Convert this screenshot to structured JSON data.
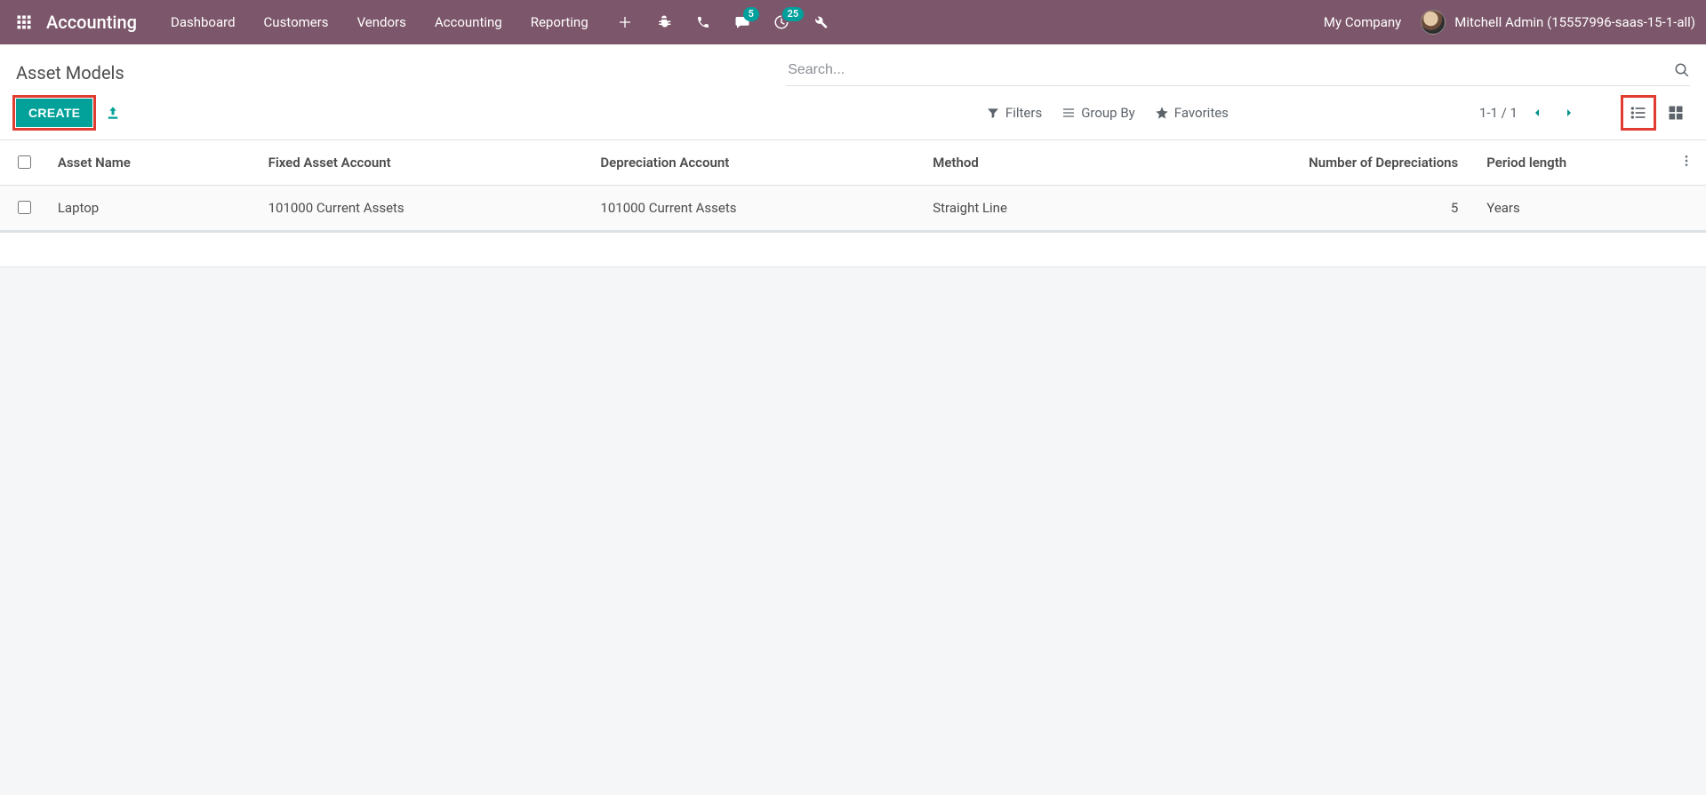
{
  "navbar": {
    "app_title": "Accounting",
    "menu": [
      "Dashboard",
      "Customers",
      "Vendors",
      "Accounting",
      "Reporting"
    ],
    "messages_badge": "5",
    "activities_badge": "25",
    "company": "My Company",
    "user": "Mitchell Admin (15557996-saas-15-1-all)"
  },
  "control_panel": {
    "breadcrumb": "Asset Models",
    "search_placeholder": "Search...",
    "create_label": "CREATE",
    "filters_label": "Filters",
    "groupby_label": "Group By",
    "favorites_label": "Favorites",
    "pager": "1-1 / 1"
  },
  "table": {
    "columns": {
      "asset_name": "Asset Name",
      "fixed_account": "Fixed Asset Account",
      "depr_account": "Depreciation Account",
      "method": "Method",
      "num_depr": "Number of Depreciations",
      "period_len": "Period length"
    },
    "rows": [
      {
        "asset_name": "Laptop",
        "fixed_account": "101000 Current Assets",
        "depr_account": "101000 Current Assets",
        "method": "Straight Line",
        "num_depr": "5",
        "period_len": "Years"
      }
    ]
  }
}
